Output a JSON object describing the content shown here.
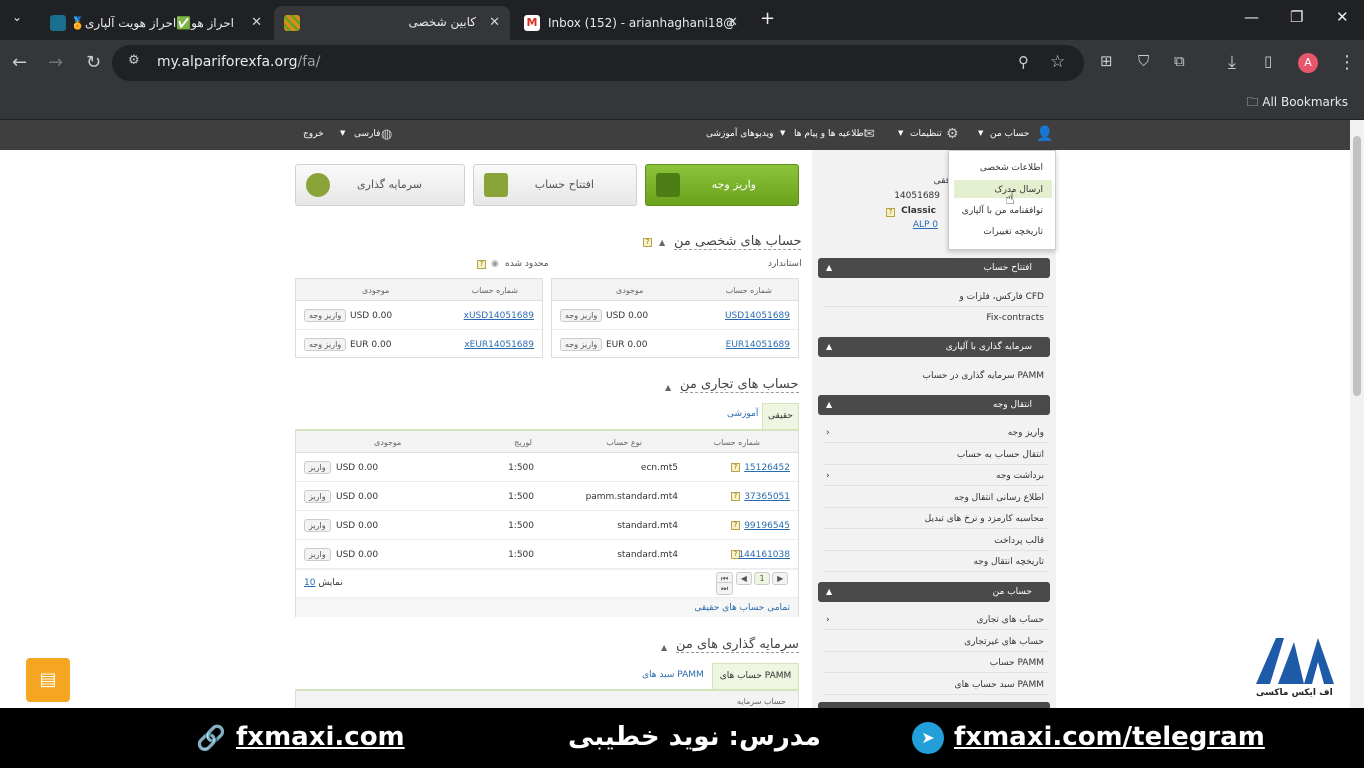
{
  "browser": {
    "tabs": [
      {
        "label": "احراز هو✅احراز هویت آلپاری🏅"
      },
      {
        "label": "کابین شخصی"
      },
      {
        "label": "Inbox (152) - arianhaghani18@"
      }
    ],
    "url_host": "my.alpariforexfa.org",
    "url_path": "/fa/",
    "bookmarks_label": "All Bookmarks",
    "avatar_letter": "A"
  },
  "topnav": {
    "account": "حساب من",
    "settings": "تنظیمات",
    "messages": "اطلاعیه ها و پیام ها",
    "videos": "ویدیوهای آموزشی",
    "language": "فارسی",
    "logout": "خروج"
  },
  "dropdown": {
    "items": [
      "اطلاعات شخصی",
      "ارسال مدرک",
      "توافقنامه من با آلپاری",
      "تاریخچه تغییرات"
    ]
  },
  "profile": {
    "name": "ققی",
    "number": "14051689",
    "type": "Classic",
    "alp": "ALP 0"
  },
  "actions": {
    "deposit": "واریز وجه",
    "open_account": "افتتاح حساب",
    "invest": "سرمایه گذاری"
  },
  "personal": {
    "title": "حساب های شخصی من",
    "standard_label": "استاندارد",
    "limited_label": "محدود شده",
    "col_account": "شماره حساب",
    "col_balance": "موجودی",
    "deposit_btn": "واریز وجه",
    "left_rows": [
      {
        "acc": "xUSD14051689",
        "bal": "USD 0.00"
      },
      {
        "acc": "xEUR14051689",
        "bal": "EUR 0.00"
      }
    ],
    "right_rows": [
      {
        "acc": "USD14051689",
        "bal": "USD 0.00"
      },
      {
        "acc": "EUR14051689",
        "bal": "EUR 0.00"
      }
    ]
  },
  "trading": {
    "title": "حساب های تجاری من",
    "tab_real": "حقیقی",
    "tab_demo": "آموزشی",
    "col_account": "شماره حساب",
    "col_type": "نوع حساب",
    "col_leverage": "لوریج",
    "col_balance": "موجودی",
    "deposit_btn": "واریز",
    "rows": [
      {
        "acc": "15126452",
        "type": "ecn.mt5",
        "lev": "1:500",
        "bal": "USD 0.00"
      },
      {
        "acc": "37365051",
        "type": "pamm.standard.mt4",
        "lev": "1:500",
        "bal": "USD 0.00"
      },
      {
        "acc": "99196545",
        "type": "standard.mt4",
        "lev": "1:500",
        "bal": "USD 0.00"
      },
      {
        "acc": "144161038",
        "type": "standard.mt4",
        "lev": "1:500",
        "bal": "USD 0.00"
      }
    ],
    "page": "1",
    "show_label": "نمایش",
    "show_count": "10",
    "all_link": "تمامی حساب های حقیقی"
  },
  "investments": {
    "title": "سرمایه گذاری های من",
    "tab_pamm": "حساب های PAMM",
    "tab_index": "سبد های PAMM",
    "col_investor": "حساب سرمایه"
  },
  "sidebar": {
    "open_account": {
      "title": "افتتاح حساب",
      "items": [
        "فارکس، فلزات و CFD",
        "Fix-contracts"
      ]
    },
    "invest": {
      "title": "سرمایه گذاری با آلپاری",
      "items": [
        "سرمایه گذاری در حساب PAMM"
      ]
    },
    "transfer": {
      "title": "انتقال وجه",
      "items": [
        "واریز وجه",
        "انتقال حساب به حساب",
        "برداشت وجه",
        "اطلاع رسانی انتقال وجه",
        "محاسبه کارمزد و نرخ های تبدیل",
        "قالب پرداخت",
        "تاریخچه انتقال وجه"
      ]
    },
    "my_account": {
      "title": "حساب من",
      "items": [
        "حساب های تجاری",
        "حساب های غیرتجاری",
        "حساب PAMM",
        "سبد حساب های PAMM"
      ]
    }
  },
  "banner": {
    "site": "fxmaxi.com",
    "teacher": "مدرس: نوید خطیبی",
    "telegram": "fxmaxi.com/telegram",
    "logo_text": "اف ایکس ماکسی"
  },
  "colors": {
    "accent_green": "#7ab32e",
    "link": "#2a6bb0",
    "chat": "#f5a623"
  }
}
